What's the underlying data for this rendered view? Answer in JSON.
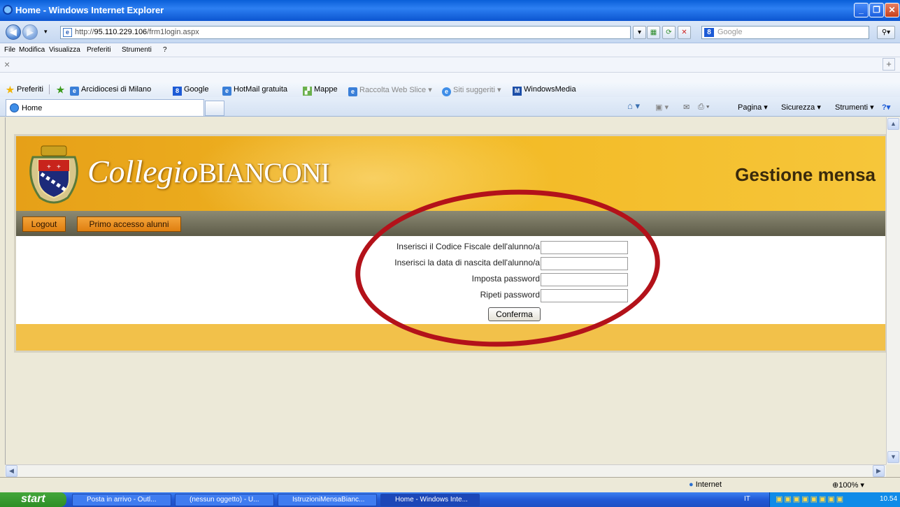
{
  "window": {
    "title": "Home - Windows Internet Explorer"
  },
  "address": {
    "url_prefix": "http://",
    "url_host": "95.110.229.106",
    "url_path": "/frm1login.aspx"
  },
  "search": {
    "placeholder": "Google"
  },
  "menu": [
    "File",
    "Modifica",
    "Visualizza",
    "Preferiti",
    "Strumenti",
    "?"
  ],
  "close_x": "×",
  "favorites": {
    "label": "Preferiti",
    "items": [
      "Arcidiocesi di Milano",
      "Google",
      "HotMail gratuita",
      "Mappe",
      "Raccolta Web Slice ▾",
      "Siti suggeriti ▾",
      "WindowsMedia"
    ]
  },
  "tab": {
    "title": "Home"
  },
  "commandbar": [
    "Pagina ▾",
    "Sicurezza ▾",
    "Strumenti ▾"
  ],
  "site": {
    "brand_script": "Collegio",
    "brand_caps": "BIANCONI",
    "section_title": "Gestione mensa",
    "nav": [
      "Logout",
      "Primo accesso alunni"
    ],
    "fields": [
      "Inserisci il Codice Fiscale dell'alunno/a",
      "Inserisci la data di nascita dell'alunno/a",
      "Imposta password",
      "Ripeti password"
    ],
    "submit": "Conferma"
  },
  "status": {
    "zone": "Internet",
    "zoom": "100%"
  },
  "taskbar": {
    "start": "start",
    "items": [
      "Posta in arrivo - Outl...",
      "(nessun oggetto) - U...",
      "IstruzioniMensaBianc...",
      "Home - Windows Inte..."
    ],
    "lang": "IT",
    "clock": "10.54"
  }
}
